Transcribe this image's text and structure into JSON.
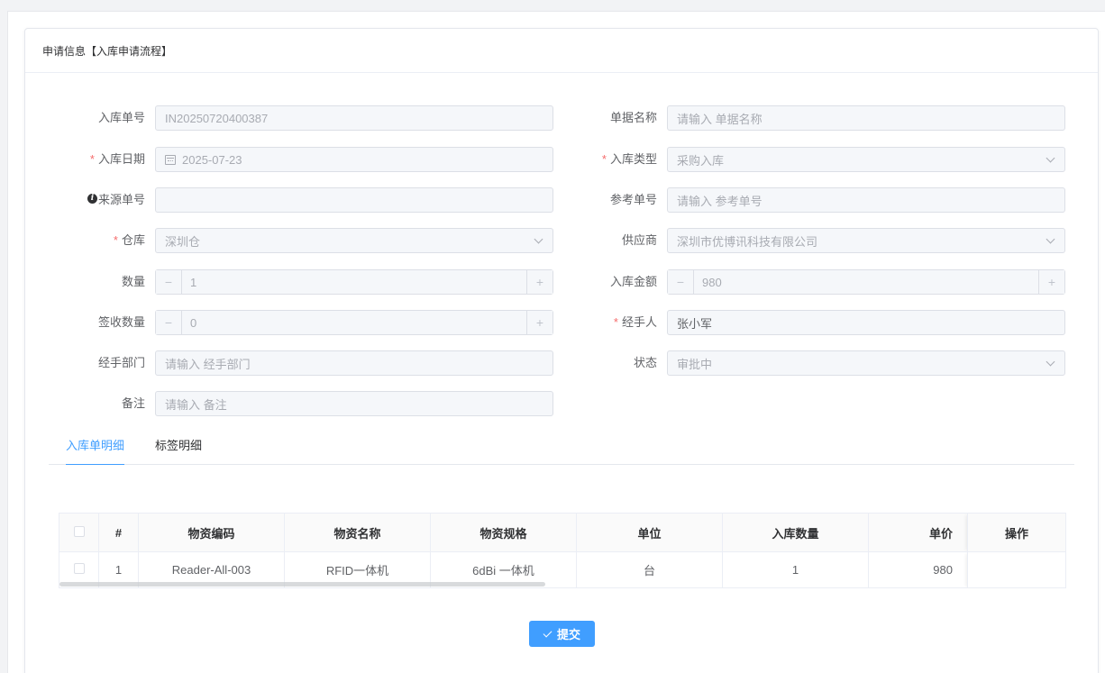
{
  "card": {
    "title": "申请信息【入库申请流程】"
  },
  "form": {
    "left": [
      {
        "label": "入库单号",
        "required": false,
        "value": "IN20250720400387",
        "placeholder": ""
      },
      {
        "label": "入库日期",
        "required": true,
        "value": "2025-07-23"
      },
      {
        "label": "来源单号",
        "info": true,
        "value": ""
      },
      {
        "label": "仓库",
        "required": true,
        "value": "深圳仓"
      },
      {
        "label": "数量",
        "value": "1",
        "minus": "−",
        "plus": "+"
      },
      {
        "label": "签收数量",
        "value": "0",
        "minus": "−",
        "plus": "+"
      },
      {
        "label": "经手部门",
        "placeholder": "请输入 经手部门"
      },
      {
        "label": "备注",
        "placeholder": "请输入 备注"
      }
    ],
    "right": [
      {
        "label": "单据名称",
        "placeholder": "请输入 单据名称"
      },
      {
        "label": "入库类型",
        "required": true,
        "value": "采购入库"
      },
      {
        "label": "参考单号",
        "placeholder": "请输入 参考单号"
      },
      {
        "label": "供应商",
        "value": "深圳市优博讯科技有限公司"
      },
      {
        "label": "入库金额",
        "value": "980",
        "minus": "−",
        "plus": "+"
      },
      {
        "label": "经手人",
        "required": true,
        "value": "张小军"
      },
      {
        "label": "状态",
        "value": "审批中"
      }
    ],
    "required_mark": "*",
    "info_mark": "i"
  },
  "tabs": [
    {
      "label": "入库单明细",
      "active": true
    },
    {
      "label": "标签明细",
      "active": false
    }
  ],
  "table": {
    "headers": [
      "#",
      "物资编码",
      "物资名称",
      "物资规格",
      "单位",
      "入库数量",
      "单价",
      "操作"
    ],
    "rows": [
      [
        "1",
        "Reader-All-003",
        "RFID一体机",
        "6dBi 一体机",
        "台",
        "1",
        "980",
        ""
      ]
    ]
  },
  "submit_label": "提交",
  "colors": {
    "primary": "#409eff",
    "required": "#f56c6c"
  }
}
